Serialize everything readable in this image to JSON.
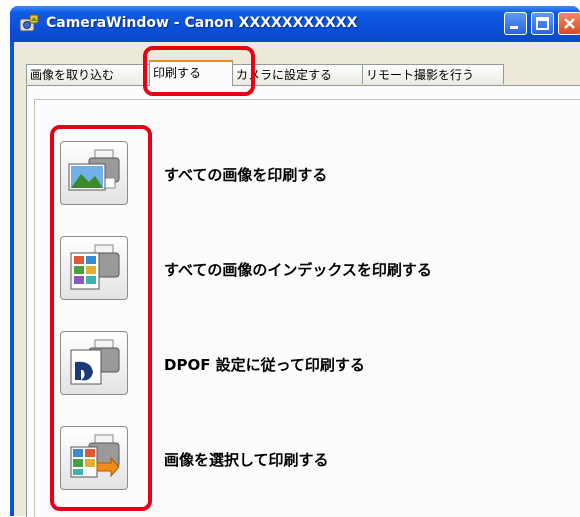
{
  "window": {
    "title": "CameraWindow - Canon XXXXXXXXXXX",
    "controls": [
      "minimize",
      "maximize",
      "close"
    ]
  },
  "tabs": [
    {
      "label": "画像を取り込む",
      "active": false
    },
    {
      "label": "印刷する",
      "active": true
    },
    {
      "label": "カメラに設定する",
      "active": false
    },
    {
      "label": "リモート撮影を行う",
      "active": false
    }
  ],
  "actions": [
    {
      "label": "すべての画像を印刷する",
      "icon": "print-all-images-icon"
    },
    {
      "label": "すべての画像のインデックスを印刷する",
      "icon": "print-index-icon"
    },
    {
      "label": "DPOF 設定に従って印刷する",
      "icon": "dpof-print-icon"
    },
    {
      "label": "画像を選択して印刷する",
      "icon": "print-selected-images-icon"
    }
  ],
  "colors": {
    "titlebar": "#0a52d6",
    "highlight": "#e60012",
    "tab_accent": "#e68b2c"
  }
}
